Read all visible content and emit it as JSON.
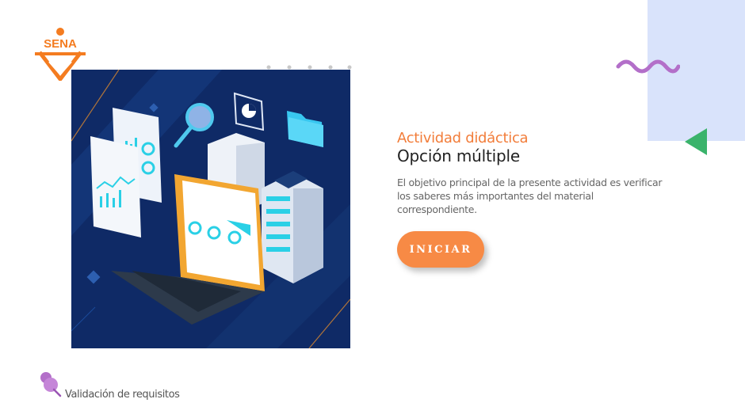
{
  "logo": {
    "text": "SENA",
    "icon": "sena-logo-icon",
    "color": "#f47c20"
  },
  "activity": {
    "subtitle": "Actividad didáctica",
    "title": "Opción múltiple",
    "description": "El objetivo principal de la presente actividad es verificar los saberes más importantes del material correspondiente."
  },
  "start_button": {
    "label": "INICIAR",
    "color": "#f78a45"
  },
  "footer": {
    "label": "Validación de requisitos",
    "icon": "pushpin-icon"
  },
  "decor": {
    "accent_orange": "#f27d3a",
    "wave_color": "#b36fc9",
    "triangle_color": "#3ab36b",
    "panel_color": "#d9e3fb"
  }
}
